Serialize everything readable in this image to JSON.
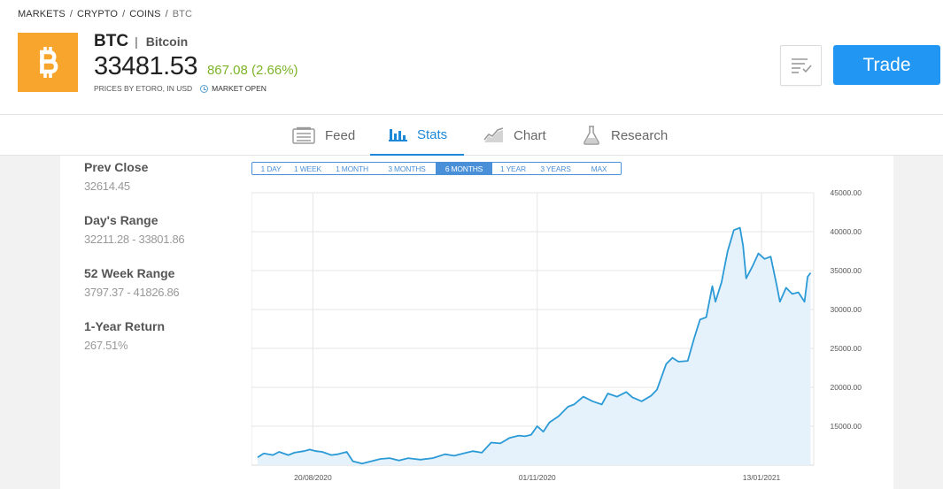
{
  "breadcrumb": [
    "MARKETS",
    "CRYPTO",
    "COINS",
    "BTC"
  ],
  "instrument": {
    "symbol": "BTC",
    "name": "Bitcoin",
    "price": "33481.53",
    "change": "867.08 (2.66%)",
    "price_note": "PRICES BY ETORO, IN USD",
    "market_status": "MARKET OPEN",
    "logo_icon": "bitcoin-icon"
  },
  "actions": {
    "trade_label": "Trade",
    "watchlist_icon": "watchlist-icon"
  },
  "tabs": [
    {
      "label": "Feed",
      "icon": "feed-icon",
      "active": false
    },
    {
      "label": "Stats",
      "icon": "bar-chart-icon",
      "active": true
    },
    {
      "label": "Chart",
      "icon": "line-chart-icon",
      "active": false
    },
    {
      "label": "Research",
      "icon": "flask-icon",
      "active": false
    }
  ],
  "stats": [
    {
      "label": "Prev Close",
      "value": "32614.45"
    },
    {
      "label": "Day's Range",
      "value": "32211.28 - 33801.86"
    },
    {
      "label": "52 Week Range",
      "value": "3797.37 - 41826.86"
    },
    {
      "label": "1-Year Return",
      "value": "267.51%"
    }
  ],
  "ranges": [
    {
      "label": "1 DAY",
      "active": false
    },
    {
      "label": "1 WEEK",
      "active": false
    },
    {
      "label": "1 MONTH",
      "active": false
    },
    {
      "label": "3 MONTHS",
      "active": false
    },
    {
      "label": "6 MONTHS",
      "active": true
    },
    {
      "label": "1 YEAR",
      "active": false
    },
    {
      "label": "3 YEARS",
      "active": false
    },
    {
      "label": "MAX",
      "active": false
    }
  ],
  "colors": {
    "accent": "#2196f3",
    "positive": "#7cb428",
    "bitcoin": "#f7a52d",
    "line": "#2b9ad6"
  },
  "chart_data": {
    "type": "area",
    "x_tick_labels": [
      "20/08/2020",
      "01/11/2020",
      "13/01/2021"
    ],
    "x_tick_days": [
      0,
      73,
      146
    ],
    "y_tick_labels": [
      "15000.00",
      "20000.00",
      "25000.00",
      "30000.00",
      "35000.00",
      "40000.00",
      "45000.00"
    ],
    "ylim": [
      10000,
      45000
    ],
    "grid": true,
    "series": [
      {
        "x_days": [
          -18,
          -16,
          -13,
          -11,
          -8,
          -6,
          -3,
          -1,
          1,
          3,
          6,
          8,
          11,
          13,
          16,
          19,
          22,
          25,
          28,
          31,
          33,
          35,
          39,
          43,
          46,
          49,
          52,
          55,
          58,
          61,
          64,
          67,
          69,
          71,
          73,
          75,
          77,
          80,
          83,
          85,
          88,
          91,
          94,
          96,
          99,
          102,
          104,
          107,
          110,
          112,
          115,
          117,
          119,
          122,
          124,
          126,
          128,
          130,
          131,
          133,
          135,
          137,
          139,
          140,
          141,
          143,
          145,
          147,
          149,
          151,
          152,
          154,
          156,
          158,
          160,
          161,
          162
        ],
        "y": [
          11000,
          11500,
          11300,
          11700,
          11300,
          11600,
          11800,
          12000,
          11800,
          11700,
          11300,
          11400,
          11700,
          10500,
          10200,
          10500,
          10800,
          10900,
          10600,
          10900,
          10800,
          10700,
          10900,
          11400,
          11200,
          11500,
          11800,
          11600,
          12900,
          12800,
          13500,
          13800,
          13700,
          13900,
          15000,
          14300,
          15500,
          16300,
          17500,
          17800,
          18800,
          18200,
          17800,
          19200,
          18800,
          19400,
          18700,
          18200,
          18900,
          19700,
          23000,
          23800,
          23300,
          23400,
          26200,
          28700,
          29000,
          33000,
          31000,
          33500,
          37500,
          40200,
          40500,
          38200,
          34000,
          35500,
          37200,
          36500,
          36800,
          33000,
          31000,
          32800,
          32000,
          32200,
          31000,
          34200,
          34700
        ]
      }
    ]
  }
}
